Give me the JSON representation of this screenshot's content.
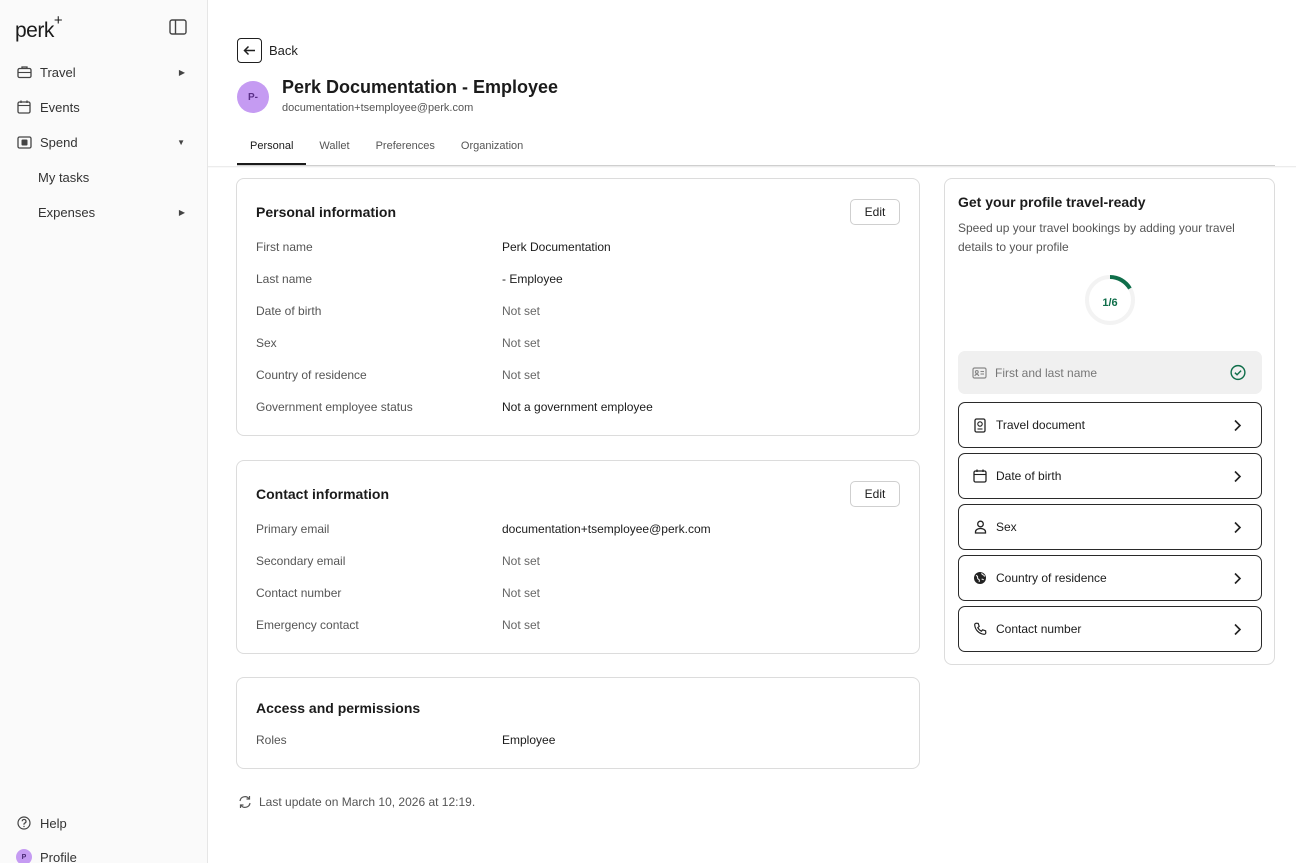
{
  "app": {
    "logo": "perk",
    "logo_plus": "+"
  },
  "sidebar": {
    "items": [
      {
        "label": "Travel",
        "icon": "briefcase-icon"
      },
      {
        "label": "Events",
        "icon": "calendar-icon"
      },
      {
        "label": "Spend",
        "icon": "wallet-icon"
      }
    ],
    "sub_items": [
      {
        "label": "My tasks"
      },
      {
        "label": "Expenses"
      }
    ],
    "bottom": {
      "help": "Help",
      "profile": "Profile",
      "profile_initial": "P"
    }
  },
  "header": {
    "back_label": "Back",
    "avatar_initials": "P-",
    "title": "Perk Documentation - Employee",
    "email": "documentation+tsemployee@perk.com",
    "tabs": [
      {
        "label": "Personal",
        "active": true
      },
      {
        "label": "Wallet"
      },
      {
        "label": "Preferences"
      },
      {
        "label": "Organization"
      }
    ]
  },
  "personal": {
    "title": "Personal information",
    "edit_label": "Edit",
    "rows": [
      {
        "label": "First name",
        "value": "Perk Documentation"
      },
      {
        "label": "Last name",
        "value": "- Employee"
      },
      {
        "label": "Date of birth",
        "value": "Not set"
      },
      {
        "label": "Sex",
        "value": "Not set"
      },
      {
        "label": "Country of residence",
        "value": "Not set"
      },
      {
        "label": "Government employee status",
        "value": "Not a government employee"
      }
    ]
  },
  "contact": {
    "title": "Contact information",
    "edit_label": "Edit",
    "rows": [
      {
        "label": "Primary email",
        "value": "documentation+tsemployee@perk.com"
      },
      {
        "label": "Secondary email",
        "value": "Not set"
      },
      {
        "label": "Contact number",
        "value": "Not set"
      },
      {
        "label": "Emergency contact",
        "value": "Not set"
      }
    ]
  },
  "access": {
    "title": "Access and permissions",
    "rows": [
      {
        "label": "Roles",
        "value": "Employee"
      }
    ]
  },
  "travel_ready": {
    "title": "Get your profile travel-ready",
    "description": "Speed up your travel bookings by adding your travel details to your profile",
    "progress_label": "1/6",
    "progress_fraction": 0.1667,
    "accent_color": "#0f6e4a",
    "tasks": [
      {
        "label": "First and last name",
        "icon": "id-card-icon",
        "done": true
      },
      {
        "label": "Travel document",
        "icon": "passport-icon"
      },
      {
        "label": "Date of birth",
        "icon": "calendar-icon"
      },
      {
        "label": "Sex",
        "icon": "person-icon"
      },
      {
        "label": "Country of residence",
        "icon": "globe-icon"
      },
      {
        "label": "Contact number",
        "icon": "phone-icon"
      }
    ]
  },
  "footer": {
    "last_update": "Last update on March 10, 2026 at 12:19."
  }
}
